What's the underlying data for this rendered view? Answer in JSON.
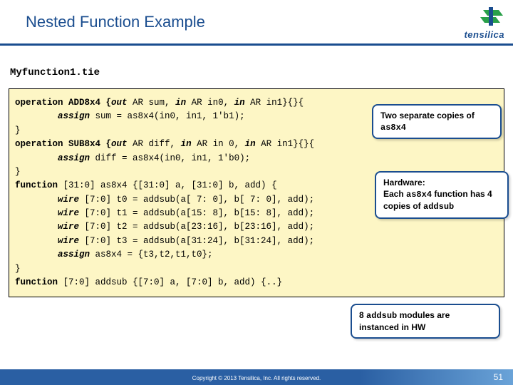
{
  "header": {
    "title": "Nested Function Example",
    "logo_text": "tensilica"
  },
  "filename": "Myfunction1.tie",
  "code": {
    "l1a": "operation ADD8x4 {",
    "l1b": "out",
    "l1c": " AR sum, ",
    "l1d": "in",
    "l1e": " AR in0, ",
    "l1f": "in",
    "l1g": " AR in1}{}{",
    "l2a": "        assign",
    "l2b": " sum = as8x4(in0, in1, 1'b1);",
    "l3": "}",
    "l4a": "operation SUB8x4 {",
    "l4b": "out",
    "l4c": " AR diff, ",
    "l4d": "in",
    "l4e": " AR in 0, ",
    "l4f": "in",
    "l4g": " AR in1}{}{",
    "l5a": "        assign",
    "l5b": " diff = as8x4(in0, in1, 1'b0);",
    "l6": "}",
    "l7a": "function",
    "l7b": " [31:0] as8x4 {[31:0] a, [31:0] b, add) {",
    "l8a": "        wire",
    "l8b": " [7:0] t0 = addsub(a[ 7: 0], b[ 7: 0], add);",
    "l9a": "        wire",
    "l9b": " [7:0] t1 = addsub(a[15: 8], b[15: 8], add);",
    "l10a": "        wire",
    "l10b": " [7:0] t2 = addsub(a[23:16], b[23:16], add);",
    "l11a": "        wire",
    "l11b": " [7:0] t3 = addsub(a[31:24], b[31:24], add);",
    "l12a": "        assign",
    "l12b": " as8x4 = {t3,t2,t1,t0};",
    "l13": "}",
    "l14a": "function",
    "l14b": " [7:0] addsub {[7:0] a, [7:0] b, add) {..}"
  },
  "callouts": {
    "c1": {
      "t1": "Two separate copies of ",
      "m1": "as8x4"
    },
    "c2": {
      "t1": "Hardware:",
      "t2": "Each ",
      "m2": "as8x4",
      "t3": " function has 4 copies of ",
      "m3": "addsub"
    },
    "c3": {
      "t1": "8 ",
      "m1": "addsub",
      "t2": " modules are instanced in HW"
    }
  },
  "footer": {
    "copyright": "Copyright © 2013  Tensilica, Inc. All rights reserved.",
    "page": "51"
  }
}
